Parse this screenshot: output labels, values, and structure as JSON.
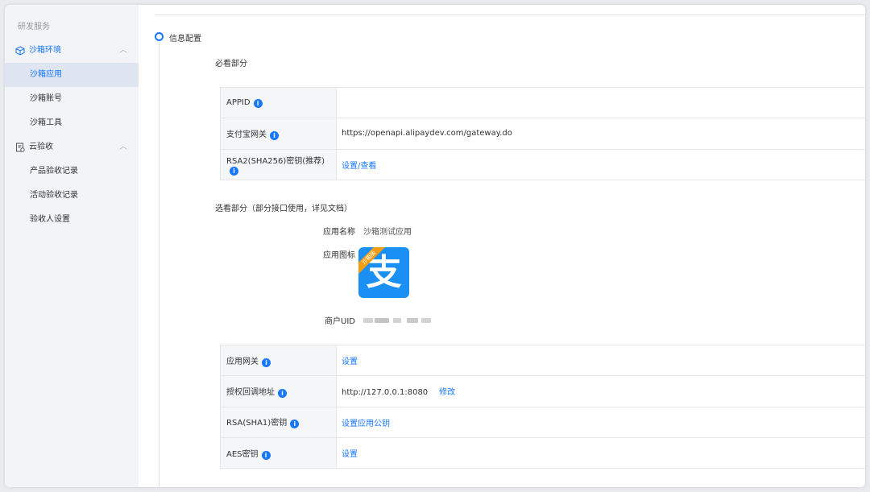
{
  "sidebar": {
    "section": "研发服务",
    "groups": [
      {
        "label": "沙箱环境",
        "icon": "cube-icon",
        "expanded": true,
        "items": [
          "沙箱应用",
          "沙箱账号",
          "沙箱工具"
        ],
        "active_index": 0
      },
      {
        "label": "云验收",
        "icon": "document-check-icon",
        "expanded": true,
        "items": [
          "产品验收记录",
          "活动验收记录",
          "验收人设置"
        ]
      }
    ]
  },
  "main": {
    "section_title": "信息配置",
    "required_title": "必看部分",
    "required_rows": [
      {
        "label": "APPID",
        "value": "",
        "link": ""
      },
      {
        "label": "支付宝网关",
        "value": "https://openapi.alipaydev.com/gateway.do",
        "link": ""
      },
      {
        "label": "RSA2(SHA256)密钥(推荐)",
        "value": "",
        "link": "设置/查看"
      }
    ],
    "optional_title": "选看部分（部分接口使用，详见文档）",
    "app_name_label": "应用名称",
    "app_name_value": "沙箱测试应用",
    "app_icon_label": "应用图标",
    "app_icon_glyph": "支",
    "app_icon_ribbon": "沙箱版",
    "merchant_uid_label": "商户UID",
    "optional_rows": [
      {
        "label": "应用网关",
        "value": "",
        "link": "设置"
      },
      {
        "label": "授权回调地址",
        "value": "http://127.0.0.1:8080",
        "link": "修改"
      },
      {
        "label": "RSA(SHA1)密钥",
        "value": "",
        "link": "设置应用公钥"
      },
      {
        "label": "AES密钥",
        "value": "",
        "link": "设置"
      }
    ],
    "accent_color": "#1677ff"
  }
}
